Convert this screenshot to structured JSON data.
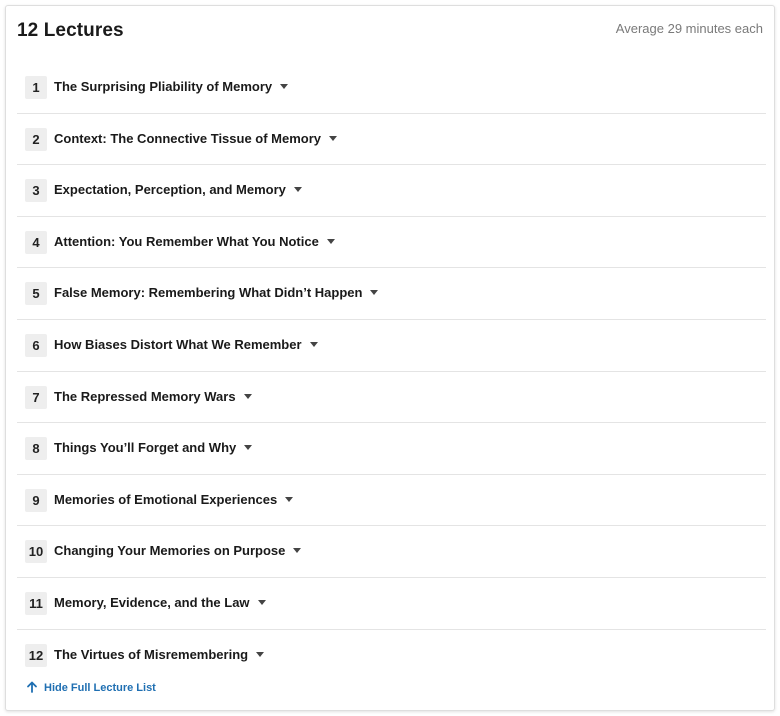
{
  "header": {
    "title": "12 Lectures",
    "meta": "Average 29 minutes each"
  },
  "lectures": [
    {
      "number": "1",
      "title": "The Surprising Pliability of Memory"
    },
    {
      "number": "2",
      "title": "Context: The Connective Tissue of Memory"
    },
    {
      "number": "3",
      "title": "Expectation, Perception, and Memory"
    },
    {
      "number": "4",
      "title": "Attention: You Remember What You Notice"
    },
    {
      "number": "5",
      "title": "False Memory: Remembering What Didn’t Happen"
    },
    {
      "number": "6",
      "title": "How Biases Distort What We Remember"
    },
    {
      "number": "7",
      "title": "The Repressed Memory Wars"
    },
    {
      "number": "8",
      "title": "Things You’ll Forget and Why"
    },
    {
      "number": "9",
      "title": "Memories of Emotional Experiences"
    },
    {
      "number": "10",
      "title": "Changing Your Memories on Purpose"
    },
    {
      "number": "11",
      "title": "Memory, Evidence, and the Law"
    },
    {
      "number": "12",
      "title": "The Virtues of Misremembering"
    }
  ],
  "footer": {
    "hide_label": "Hide Full Lecture List"
  },
  "colors": {
    "link": "#1f6fb2",
    "number_badge_bg": "#eeeeee",
    "divider": "#e4e4e4",
    "meta_text": "#7a7a7a"
  },
  "icons": {
    "row_toggle": "caret-down-icon",
    "hide_list": "arrow-up-icon"
  }
}
